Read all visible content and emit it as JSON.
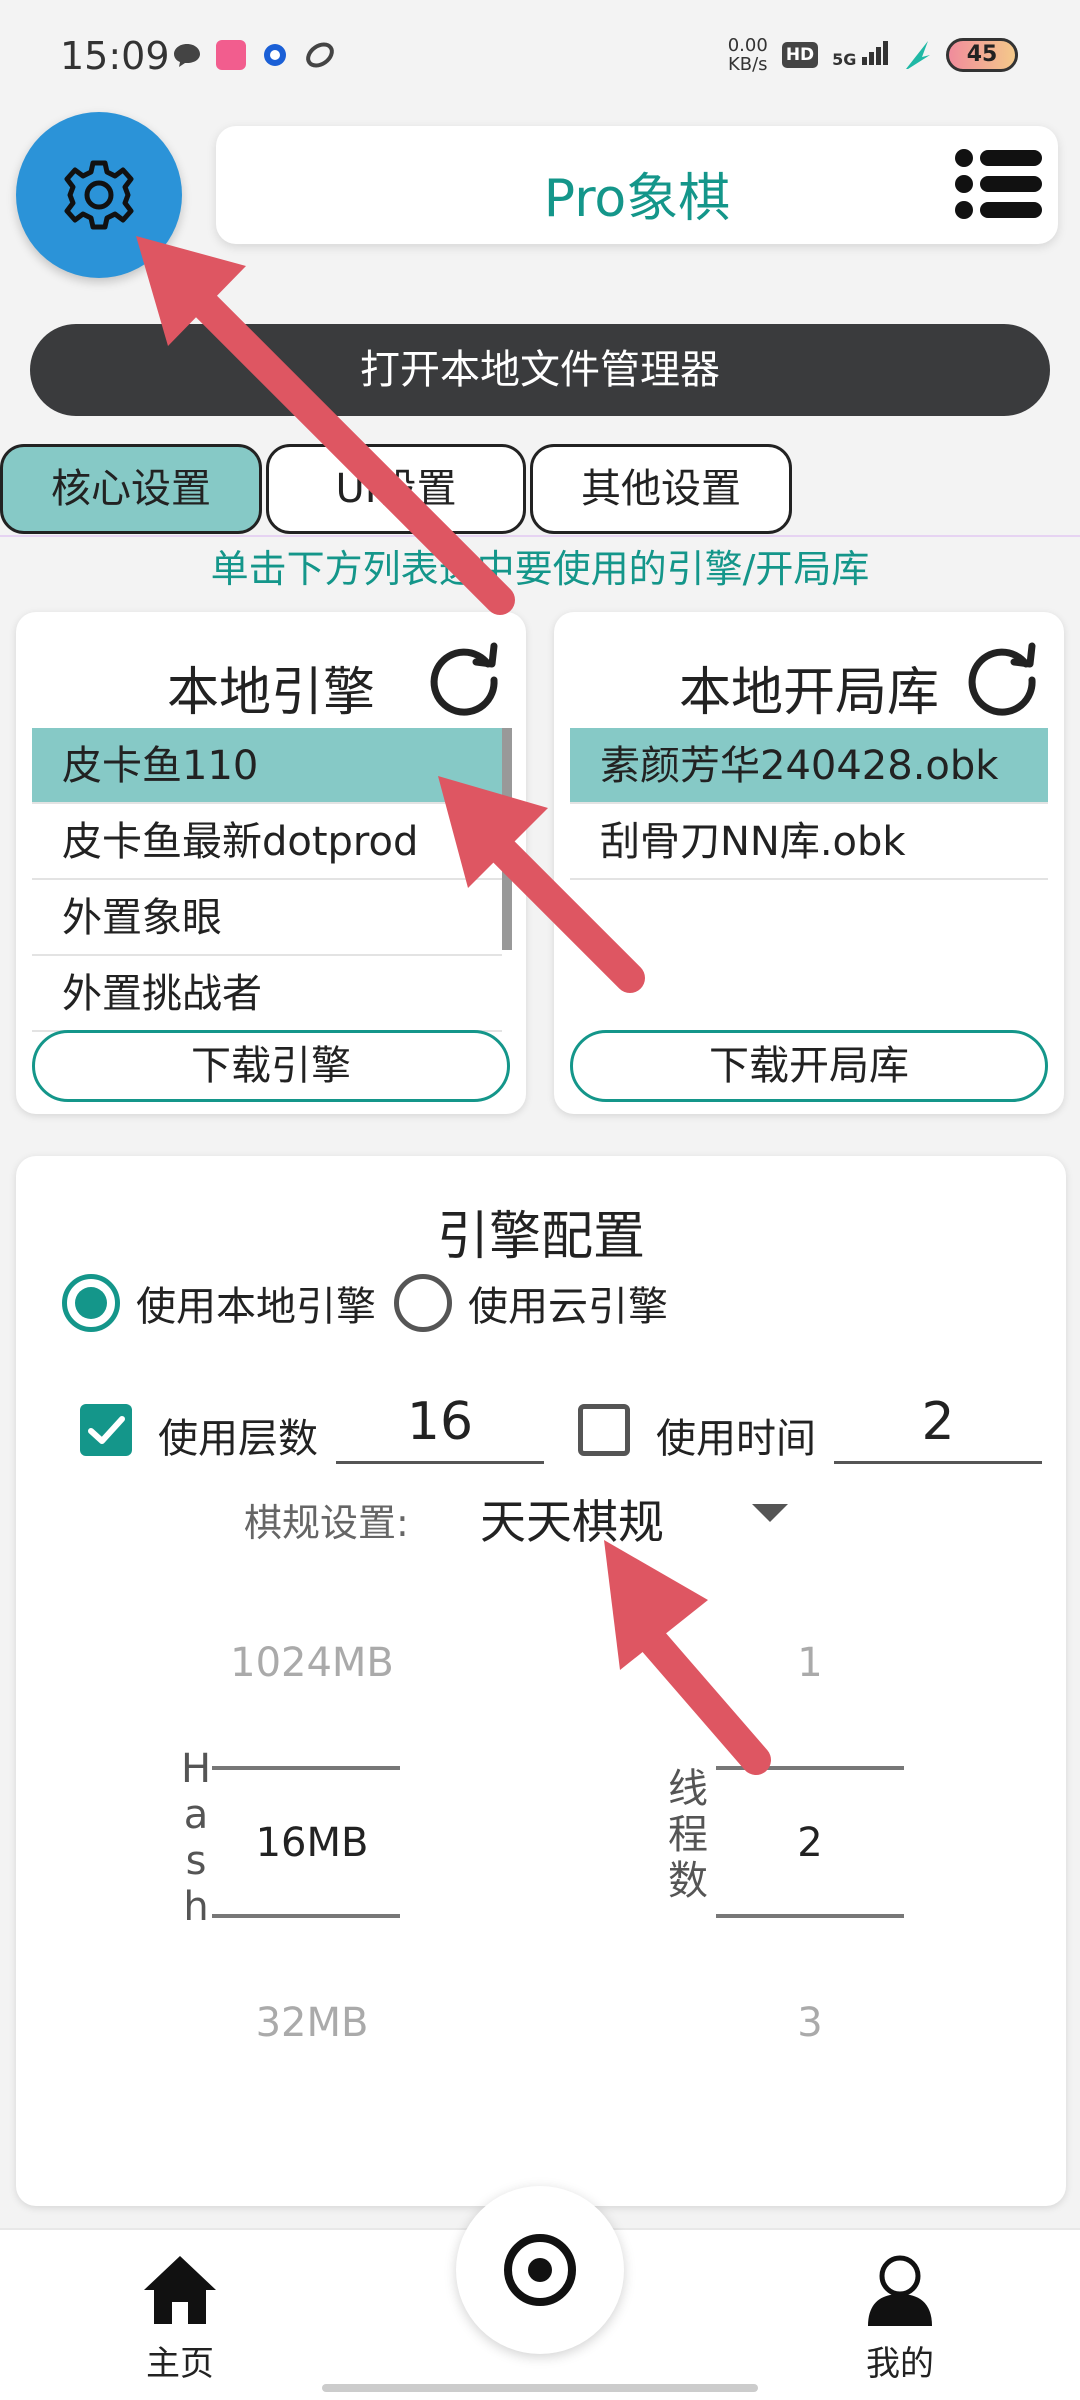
{
  "status_bar": {
    "time": "15:09",
    "speed_top": "0.00",
    "speed_bottom": "KB/s",
    "hd": "HD",
    "network": "5G",
    "battery": "45"
  },
  "header": {
    "title": "Pro象棋",
    "settings_icon": "gear-icon",
    "menu_icon": "menu-icon"
  },
  "open_file_manager_label": "打开本地文件管理器",
  "tabs": [
    {
      "label": "核心设置",
      "active": true
    },
    {
      "label": "UI设置",
      "active": false
    },
    {
      "label": "其他设置",
      "active": false
    }
  ],
  "hint": "单击下方列表选中要使用的引擎/开局库",
  "engines": {
    "title": "本地引擎",
    "items": [
      "皮卡鱼110",
      "皮卡鱼最新dotprod",
      "外置象眼",
      "外置挑战者"
    ],
    "selected_index": 0,
    "download_label": "下载引擎"
  },
  "books": {
    "title": "本地开局库",
    "items": [
      "素颜芳华240428.obk",
      "刮骨刀NN库.obk"
    ],
    "selected_index": 0,
    "download_label": "下载开局库"
  },
  "engine_config": {
    "title": "引擎配置",
    "radio_local": "使用本地引擎",
    "radio_cloud": "使用云引擎",
    "use_depth_label": "使用层数",
    "depth_value": "16",
    "use_time_label": "使用时间",
    "time_value": "2",
    "rule_label": "棋规设置:",
    "rule_value": "天天棋规",
    "hash_label": [
      "H",
      "a",
      "s",
      "h"
    ],
    "hash_values": {
      "prev": "1024MB",
      "current": "16MB",
      "next": "32MB"
    },
    "threads_label": [
      "线",
      "程",
      "数"
    ],
    "thread_values": {
      "prev": "1",
      "current": "2",
      "next": "3"
    }
  },
  "bottom_nav": {
    "home": "主页",
    "mine": "我的"
  },
  "colors": {
    "accent": "#14968a",
    "selected_row": "#86c9c6",
    "settings_button": "#2b93d8",
    "arrow_annotation": "#de5662"
  }
}
